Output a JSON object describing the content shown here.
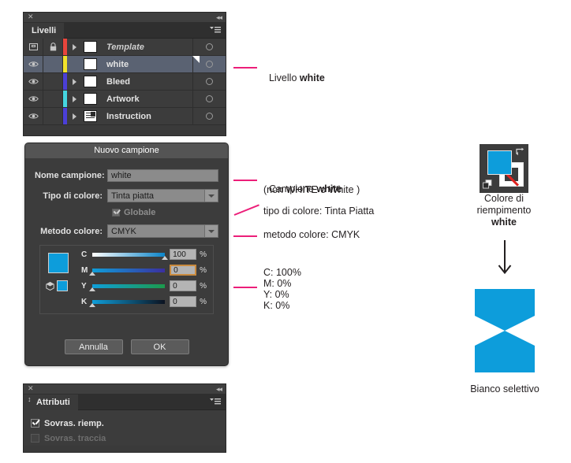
{
  "colors": {
    "accent_magenta": "#ec1e79",
    "brand_blue": "#0d9ddb",
    "panel_bg": "#3c3c3c",
    "selection_blue": "#5a6272",
    "focus_orange": "#c98a3e",
    "stroke_red": "#e0221f"
  },
  "layers_panel": {
    "tab_label": "Livelli",
    "close_icon": "close-icon",
    "collapse_icon": "double-chevron-left-icon",
    "menu_icon": "panel-menu-icon",
    "rows": [
      {
        "name": "Template",
        "italic": true,
        "visibility_icon": "layer-indicator-icon",
        "locked": true,
        "lock_icon": "lock-icon",
        "has_arrow": true,
        "color_bar": "#e8453c",
        "thumb": "blank",
        "target_icon": "target-circle-icon",
        "selected": false
      },
      {
        "name": "white",
        "italic": false,
        "visibility_icon": "eye-icon",
        "locked": false,
        "lock_icon": "",
        "has_arrow": false,
        "color_bar": "#f2e32a",
        "thumb": "blank",
        "target_icon": "target-circle-icon",
        "selected": true
      },
      {
        "name": "Bleed",
        "italic": false,
        "visibility_icon": "eye-icon",
        "locked": false,
        "lock_icon": "",
        "has_arrow": true,
        "color_bar": "#4b3fd8",
        "thumb": "blank",
        "target_icon": "target-circle-icon",
        "selected": false
      },
      {
        "name": "Artwork",
        "italic": false,
        "visibility_icon": "eye-icon",
        "locked": false,
        "lock_icon": "",
        "has_arrow": true,
        "color_bar": "#45d6e0",
        "thumb": "blank",
        "target_icon": "target-circle-icon",
        "selected": false
      },
      {
        "name": "Instruction",
        "italic": false,
        "visibility_icon": "eye-icon",
        "locked": false,
        "lock_icon": "",
        "has_arrow": true,
        "thumb": "content",
        "target_icon": "target-circle-icon",
        "selected": false
      }
    ]
  },
  "swatch_dialog": {
    "title": "Nuovo campione",
    "fields": {
      "name_label": "Nome campione:",
      "name_value": "white",
      "color_type_label": "Tipo di colore:",
      "color_type_value": "Tinta piatta",
      "global_label": "Globale",
      "global_checked": true,
      "global_disabled": true,
      "color_mode_label": "Metodo colore:",
      "color_mode_value": "CMYK"
    },
    "sliders": [
      {
        "channel": "C",
        "value": "100",
        "unit": "%",
        "focused": false,
        "track_from": "#ffffff",
        "track_to": "#0b84c8"
      },
      {
        "channel": "M",
        "value": "0",
        "unit": "%",
        "focused": true,
        "track_from": "#0f9ed9",
        "track_to": "#3b2fa0"
      },
      {
        "channel": "Y",
        "value": "0",
        "unit": "%",
        "focused": false,
        "track_from": "#0f9ed9",
        "track_to": "#1c9a4c"
      },
      {
        "channel": "K",
        "value": "0",
        "unit": "%",
        "focused": false,
        "track_from": "#0f9ed9",
        "track_to": "#0b1220"
      }
    ],
    "buttons": {
      "cancel": "Annulla",
      "ok": "OK"
    }
  },
  "attributes_panel": {
    "tab_label": "Attributi",
    "close_icon": "close-icon",
    "collapse_icon": "double-chevron-left-icon",
    "menu_icon": "panel-menu-icon",
    "rows": [
      {
        "label": "Sovras. riemp.",
        "checked": true,
        "disabled": false
      },
      {
        "label": "Sovras. traccia",
        "checked": false,
        "disabled": true
      }
    ]
  },
  "annotations": {
    "layer_white": "Livello ",
    "layer_white_bold": "white",
    "swatch_line1": "Campione ",
    "swatch_line1_bold": "white",
    "swatch_line2": "(non WHITE o White )",
    "color_type": "tipo di colore: Tinta Piatta",
    "color_mode": "metodo colore: CMYK",
    "cmyk_values": "C: 100%\nM: 0%\nY: 0%\nK: 0%"
  },
  "right_column": {
    "fill_indicator_icon": "fill-stroke-indicator-icon",
    "swap_icon": "swap-fill-stroke-icon",
    "default_icon": "default-fill-stroke-icon",
    "fill_caption_line1": "Colore di",
    "fill_caption_line2": "riempimento",
    "fill_caption_bold": "white",
    "arrow_icon": "arrow-down-icon",
    "shape_icon": "hourglass-shape",
    "shape_caption": "Bianco selettivo"
  }
}
